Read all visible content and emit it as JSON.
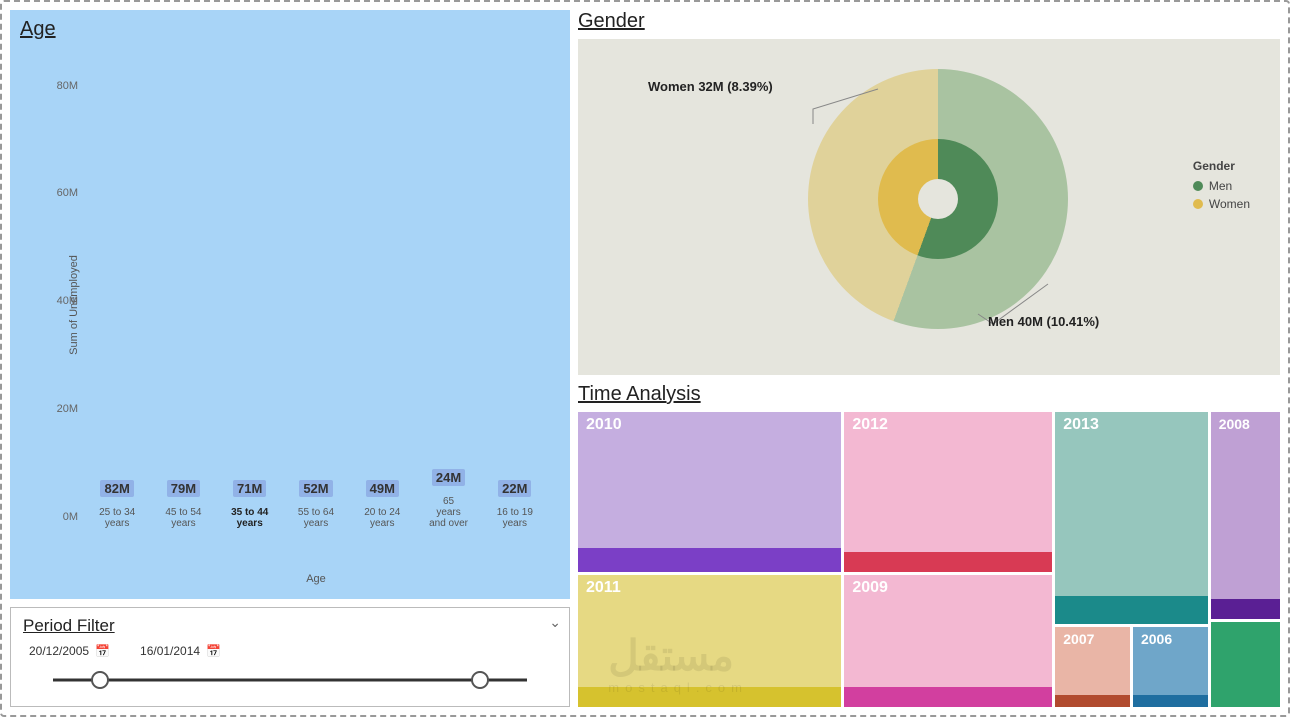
{
  "chart_data": [
    {
      "type": "bar",
      "id": "age",
      "title": "Age",
      "ylabel": "Sum of Unemployed",
      "xlabel": "Age",
      "ylim": [
        0,
        85
      ],
      "yticks": [
        "0M",
        "20M",
        "40M",
        "60M",
        "80M"
      ],
      "categories": [
        "25 to 34 years",
        "45 to 54 years",
        "35 to 44 years",
        "55 to 64 years",
        "20 to 24 years",
        "65 years and over",
        "16 to 19 years"
      ],
      "values_label": [
        "82M",
        "79M",
        "71M",
        "52M",
        "49M",
        "24M",
        "22M"
      ],
      "values": [
        82,
        79,
        71,
        52,
        49,
        24,
        22
      ],
      "highlight_index": 2
    },
    {
      "type": "pie",
      "id": "gender",
      "title": "Gender",
      "legend_title": "Gender",
      "series": [
        {
          "name": "Men",
          "value": 40,
          "pct": 10.41,
          "label": "Men 40M (10.41%)",
          "color_outer": "#a9c3a1",
          "color_inner": "#4f8a58"
        },
        {
          "name": "Women",
          "value": 32,
          "pct": 8.39,
          "label": "Women 32M (8.39%)",
          "color_outer": "#e0d29a",
          "color_inner": "#e0bb4e"
        }
      ]
    },
    {
      "type": "treemap",
      "id": "time",
      "title": "Time Analysis",
      "items": [
        {
          "year": "2010",
          "color": "#c5aee0",
          "strip": "#7b3fc6"
        },
        {
          "year": "2011",
          "color": "#e6d983",
          "strip": "#d6c22e"
        },
        {
          "year": "2012",
          "color": "#f3b8d2",
          "strip": "#d83a54"
        },
        {
          "year": "2009",
          "color": "#f3b8d2",
          "strip": "#d23f9f"
        },
        {
          "year": "2013",
          "color": "#96c6bd",
          "strip": "#1b8a8a"
        },
        {
          "year": "2008",
          "color": "#bfa0d4",
          "strip": "#5a1f94"
        },
        {
          "year": "2007",
          "color": "#e9b5a6",
          "strip": "#b14b2f"
        },
        {
          "year": "2006",
          "color": "#6fa6c9",
          "strip": "#1f6ea0"
        },
        {
          "year": "",
          "color": "#2fa36c",
          "strip": "#2fa36c"
        }
      ]
    }
  ],
  "period_filter": {
    "title": "Period Filter",
    "from": "20/12/2005",
    "to": "16/01/2014"
  },
  "watermark": {
    "big": "مستقل",
    "small": "mostaql.com"
  }
}
